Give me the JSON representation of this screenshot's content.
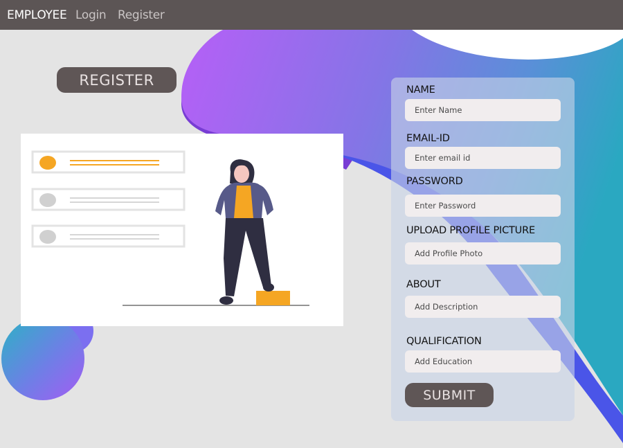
{
  "navbar": {
    "brand": "EMPLOYEE",
    "links": [
      "Login",
      "Register"
    ]
  },
  "hero": {
    "badge": "REGISTER"
  },
  "form": {
    "fields": [
      {
        "label": "NAME",
        "placeholder": "Enter Name"
      },
      {
        "label": "EMAIL-ID",
        "placeholder": "Enter email id"
      },
      {
        "label": "PASSWORD",
        "placeholder": "Enter Password"
      },
      {
        "label": "UPLOAD PROFILE PICTURE",
        "placeholder": "Add Profile Photo"
      },
      {
        "label": "ABOUT",
        "placeholder": "Add Description"
      },
      {
        "label": "QUALIFICATION",
        "placeholder": "Add Education"
      }
    ],
    "submit_label": "SUBMIT"
  },
  "colors": {
    "navbar": "#5c5555",
    "accent_purple": "#a95cf6",
    "accent_teal": "#2aa6c2",
    "button": "#5f5656",
    "highlight_orange": "#f5a623"
  }
}
